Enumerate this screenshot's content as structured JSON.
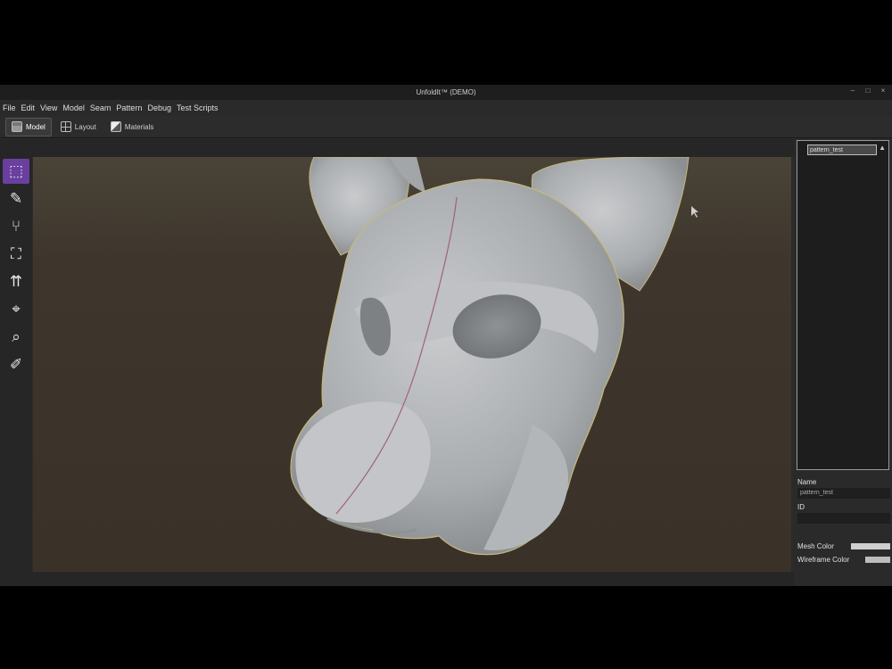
{
  "window": {
    "title": "UnfoldIt™ (DEMO)",
    "controls": [
      "–",
      "□",
      "×"
    ]
  },
  "menu": [
    "File",
    "Edit",
    "View",
    "Model",
    "Seam",
    "Pattern",
    "Debug",
    "Test Scripts"
  ],
  "tabs": [
    {
      "label": "Model",
      "icon": "cube-icon",
      "active": true
    },
    {
      "label": "Layout",
      "icon": "grid-icon",
      "active": false
    },
    {
      "label": "Materials",
      "icon": "materials-icon",
      "active": false
    }
  ],
  "tools": [
    {
      "name": "select-tool",
      "glyph": "⬚",
      "active": true
    },
    {
      "name": "brush-tool",
      "glyph": "✎",
      "active": false
    },
    {
      "name": "seam-tool",
      "glyph": "⑂",
      "active": false
    },
    {
      "name": "paint-bucket-tool",
      "glyph": "⛶",
      "active": false
    },
    {
      "name": "move-up-tool",
      "glyph": "⇈",
      "active": false
    },
    {
      "name": "transform-tool",
      "glyph": "⌖",
      "active": false
    },
    {
      "name": "zoom-tool",
      "glyph": "⌕",
      "active": false
    },
    {
      "name": "edit-tool",
      "glyph": "✐",
      "active": false
    }
  ],
  "outliner": {
    "items": [
      "pattern_test"
    ]
  },
  "properties": {
    "name_label": "Name",
    "name_value": "pattern_test",
    "id_label": "ID",
    "id_value": "",
    "mesh_color_label": "Mesh Color",
    "wireframe_color_label": "Wireframe Color"
  },
  "colors": {
    "active_tool": "#6b3fa0",
    "seam_line": "#a0607a",
    "mesh": "#b9bcbf"
  }
}
